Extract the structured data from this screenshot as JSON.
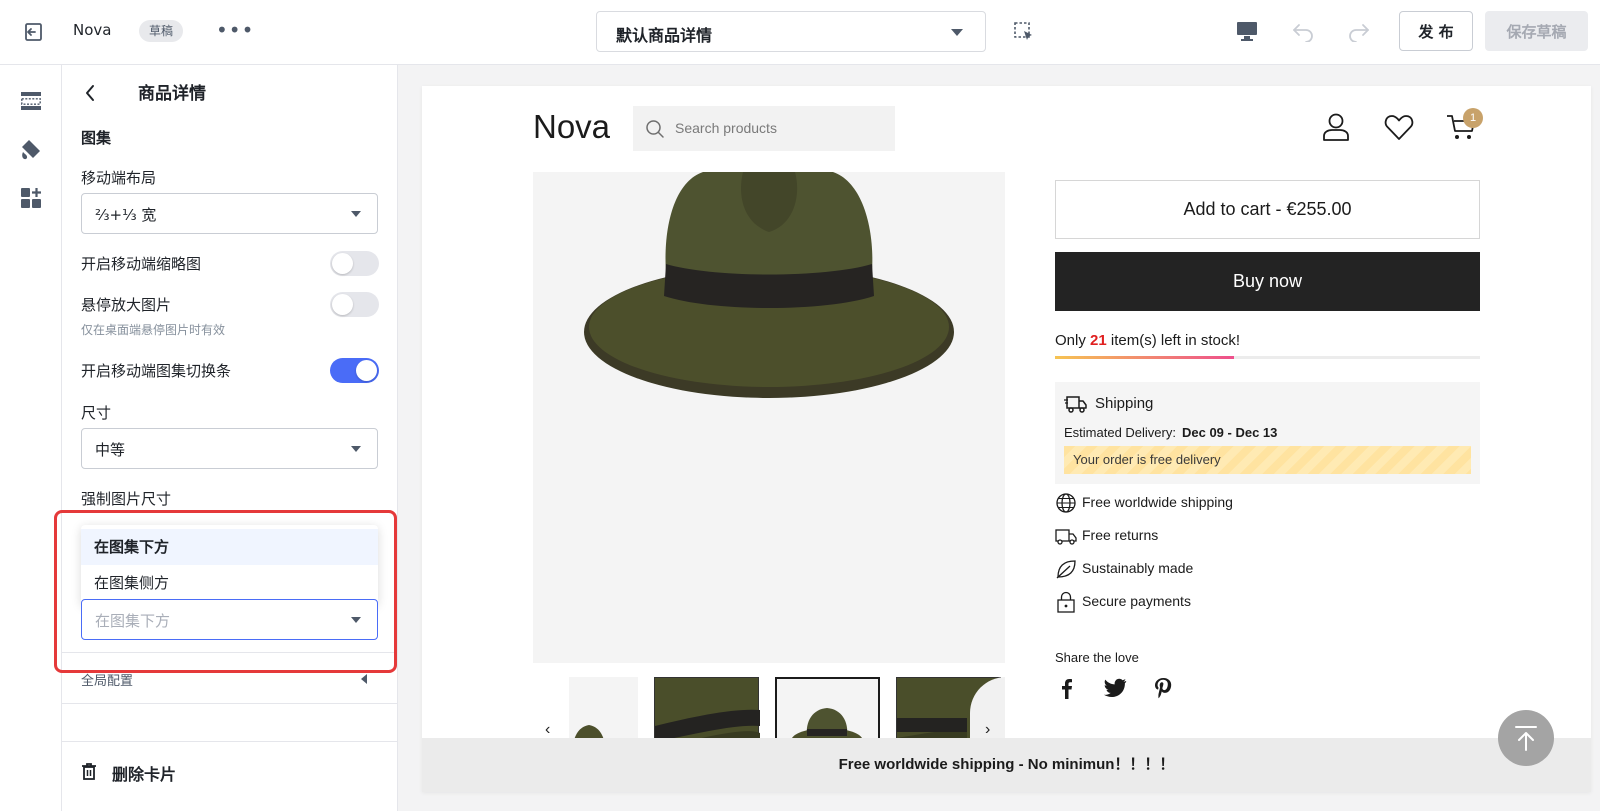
{
  "topbar": {
    "store_name": "Nova",
    "status_badge": "草稿",
    "more_label": "•••",
    "template_select": "默认商品详情",
    "publish_label": "发 布",
    "save_draft_label": "保存草稿",
    "icons": [
      "exit-icon",
      "element-picker-icon",
      "desktop-icon",
      "undo-icon",
      "redo-icon"
    ]
  },
  "rail": {
    "icons": [
      "sections-icon",
      "theme-brush-icon",
      "add-widget-icon"
    ]
  },
  "panel": {
    "title": "商品详情",
    "section": "图集",
    "mobile_layout_label": "移动端布局",
    "mobile_layout_value": "⅔+⅓ 宽",
    "mobile_thumbs_label": "开启移动端缩略图",
    "mobile_thumbs_on": false,
    "hover_zoom_label": "悬停放大图片",
    "hover_zoom_hint": "仅在桌面端悬停图片时有效",
    "hover_zoom_on": false,
    "mobile_switcher_label": "开启移动端图集切换条",
    "mobile_switcher_on": true,
    "size_label": "尺寸",
    "size_value": "中等",
    "force_size_label": "强制图片尺寸",
    "dropdown_options": [
      "在图集下方",
      "在图集侧方"
    ],
    "dropdown_active": "在图集下方",
    "position_select_value": "在图集下方",
    "global_config_label": "全局配置",
    "delete_card_label": "删除卡片"
  },
  "preview": {
    "logo": "Nova",
    "search_placeholder": "Search products",
    "cart_count": "1",
    "add_to_cart": "Add to cart  -  €255.00",
    "buy_now": "Buy now",
    "stock_prefix": "Only ",
    "stock_count": "21",
    "stock_suffix": " item(s) left in stock!",
    "stock_fraction": 0.42,
    "shipping_title": "Shipping",
    "estimated_label": "Estimated Delivery:",
    "estimated_dates": "Dec 09 - Dec 13",
    "free_delivery_note": "Your order is free delivery",
    "features": [
      {
        "icon": "globe-icon",
        "label": "Free worldwide shipping"
      },
      {
        "icon": "truck-icon",
        "label": "Free returns"
      },
      {
        "icon": "leaf-icon",
        "label": "Sustainably made"
      },
      {
        "icon": "lock-icon",
        "label": "Secure payments"
      }
    ],
    "share_label": "Share the love",
    "social_icons": [
      "facebook-icon",
      "twitter-icon",
      "pinterest-icon"
    ],
    "footer_banner": "Free worldwide shipping - No minimun！！！！",
    "thumb_prev": "‹",
    "thumb_next": "›"
  },
  "colors": {
    "accent": "#4a6cf7",
    "highlight_border": "#e5393a",
    "buy_now_bg": "#232323",
    "stock_number": "#e02020",
    "cart_badge": "#c8a26a"
  }
}
